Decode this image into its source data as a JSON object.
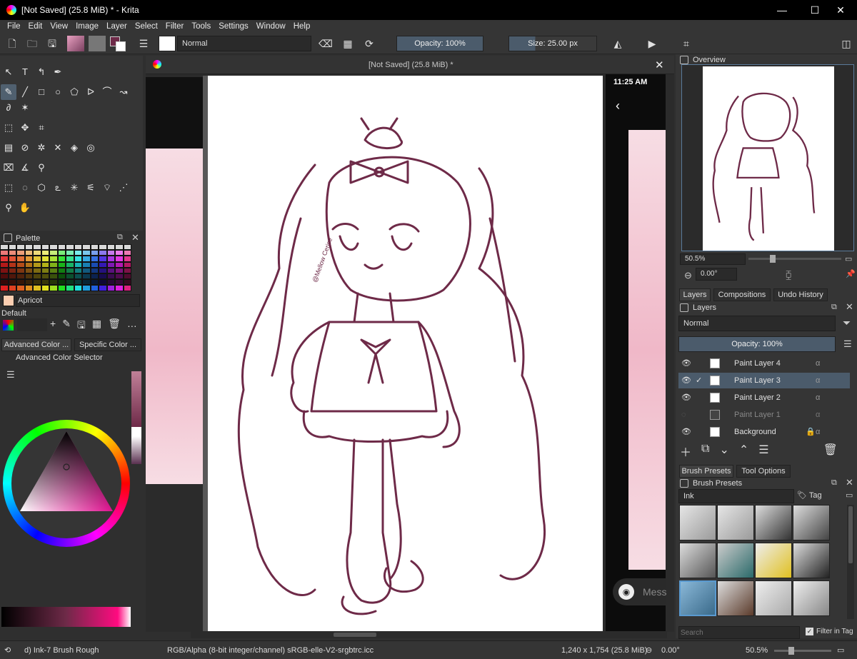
{
  "window": {
    "title": "[Not Saved]  (25.8 MiB) * - Krita",
    "minimize": "—",
    "maximize": "☐",
    "close": "✕"
  },
  "menu": [
    "File",
    "Edit",
    "View",
    "Image",
    "Layer",
    "Select",
    "Filter",
    "Tools",
    "Settings",
    "Window",
    "Help"
  ],
  "toolbar": {
    "blend_mode": "Normal",
    "opacity": "Opacity: 100%",
    "size": "Size: 25.00 px"
  },
  "document": {
    "tab_title": "[Not Saved]  (25.8 MiB) *"
  },
  "palette": {
    "title": "Palette",
    "selected_color": "Apricot",
    "palette_name": "Default"
  },
  "color_selector": {
    "tab1": "Advanced Color ...",
    "tab2": "Specific Color ...",
    "title": "Advanced Color Selector"
  },
  "overview": {
    "title": "Overview",
    "zoom": "50.5%",
    "rotation": "0.00°"
  },
  "layers_tabs": [
    "Layers",
    "Compositions",
    "Undo History"
  ],
  "layers": {
    "title": "Layers",
    "blend_mode": "Normal",
    "opacity": "Opacity:  100%",
    "items": [
      {
        "name": "Paint Layer 4"
      },
      {
        "name": "Paint Layer 3"
      },
      {
        "name": "Paint Layer 2"
      },
      {
        "name": "Paint Layer 1"
      },
      {
        "name": "Background"
      }
    ]
  },
  "brush_tabs": [
    "Brush Presets",
    "Tool Options"
  ],
  "brush_presets": {
    "title": "Brush Presets",
    "filter": "Ink",
    "tag": "Tag",
    "search_placeholder": "Search",
    "filter_in_tag": "Filter in Tag"
  },
  "phone": {
    "time": "11:25 AM",
    "message_hint": "Mess"
  },
  "signature": "@Mellow Cerise",
  "status": {
    "brush": "d) Ink-7 Brush Rough",
    "color_model": "RGB/Alpha (8-bit integer/channel)  sRGB-elle-V2-srgbtrc.icc",
    "dimensions": "1,240 x 1,754 (25.8 MiB)",
    "rotation": "0.00°",
    "zoom": "50.5%"
  },
  "colors": {
    "accent": "#4b5b6b",
    "line_art": "#6e2a48",
    "bg": "#353535"
  }
}
